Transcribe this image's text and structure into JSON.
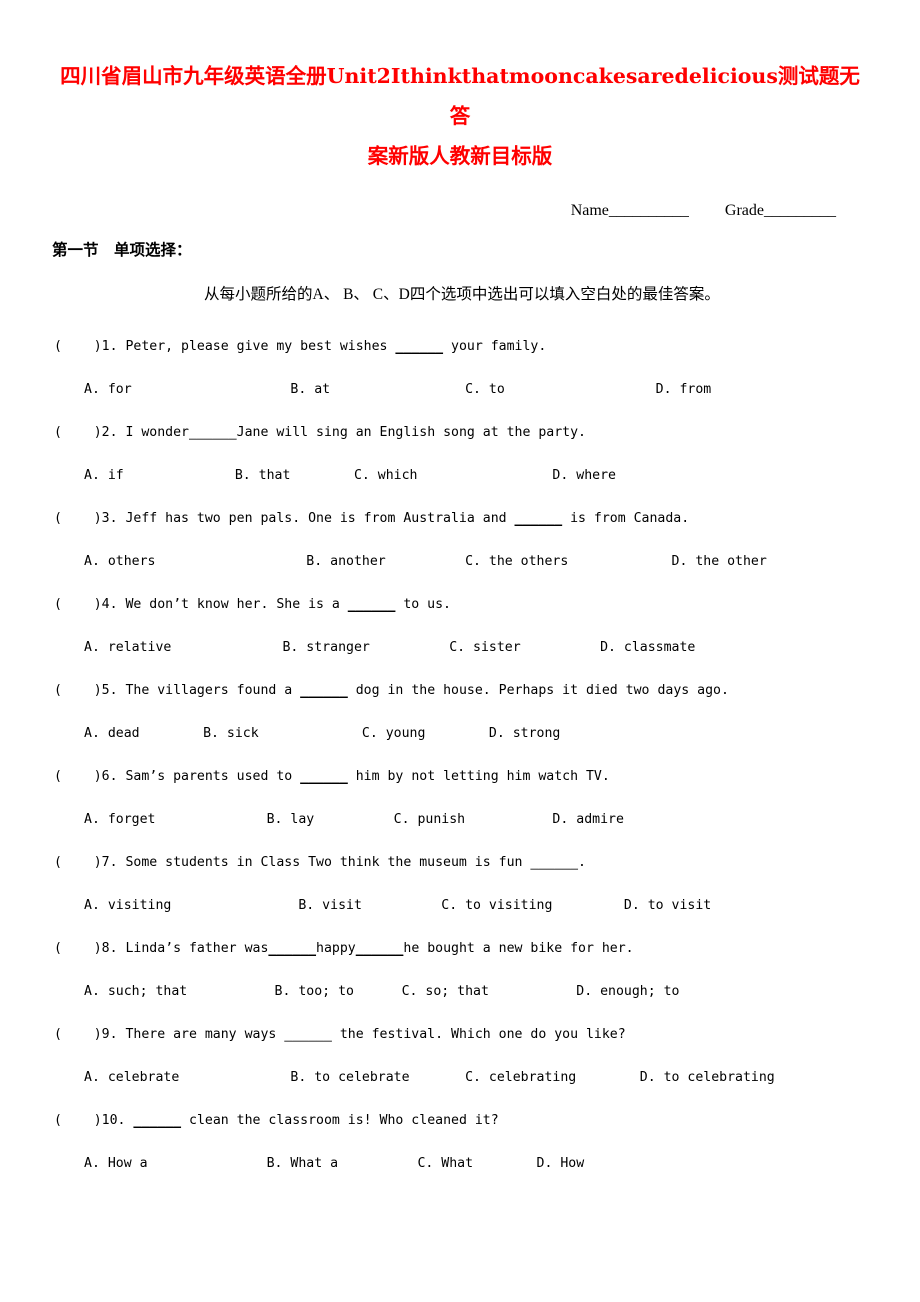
{
  "document": {
    "title_line1": "四川省眉山市九年级英语全册Unit2Ithinkthatmooncakesaredelicious测试题无答",
    "title_line2": "案新版人教新目标版",
    "title_color": "#ff0000",
    "name_label": "Name",
    "name_blank": "__________",
    "grade_label": "Grade",
    "grade_blank": "_________",
    "section_heading": "第一节　单项选择：",
    "instruction": "从每小题所给的A、 B、 C、D四个选项中选出可以填入空白处的最佳答案。"
  },
  "questions": [
    {
      "marker": "(    )1.",
      "stem_before": " Peter, please give my best wishes ",
      "blank": "______",
      "blank_style": "solid",
      "stem_after": " your family.",
      "options_text": "A. for                    B. at                 C. to                   D. from",
      "options": [
        "A. for",
        "B. at",
        "C. to",
        "D. from"
      ]
    },
    {
      "marker": "(    )2.",
      "stem_before": " I wonder",
      "blank": "______",
      "blank_style": "light",
      "stem_after": "Jane will sing an English song at the party.",
      "options_text": "A. if              B. that        C. which                 D. where",
      "options": [
        "A. if",
        "B. that",
        "C. which",
        "D. where"
      ]
    },
    {
      "marker": "(    )3.",
      "stem_before": " Jeff has two pen pals. One is from Australia and ",
      "blank": "______",
      "blank_style": "solid",
      "stem_after": " is from Canada.",
      "options_text": "A. others                   B. another          C. the others             D. the other",
      "options": [
        "A. others",
        "B. another",
        "C. the others",
        "D. the other"
      ]
    },
    {
      "marker": "(    )4.",
      "stem_before": " We don’t know her. She is a ",
      "blank": "______",
      "blank_style": "solid",
      "stem_after": " to us.",
      "options_text": "A. relative              B. stranger          C. sister          D. classmate",
      "options": [
        "A. relative",
        "B. stranger",
        "C. sister",
        "D. classmate"
      ]
    },
    {
      "marker": "(    )5.",
      "stem_before": " The villagers found a ",
      "blank": "______",
      "blank_style": "solid",
      "stem_after": " dog in the house. Perhaps it died two days ago.",
      "options_text": "A. dead        B. sick             C. young        D. strong",
      "options": [
        "A. dead",
        "B. sick",
        "C. young",
        "D. strong"
      ]
    },
    {
      "marker": "(    )6.",
      "stem_before": " Sam’s parents used to ",
      "blank": "______",
      "blank_style": "solid",
      "stem_after": " him by not letting him watch TV.",
      "options_text": "A. forget              B. lay          C. punish           D. admire",
      "options": [
        "A. forget",
        "B. lay",
        "C. punish",
        "D. admire"
      ]
    },
    {
      "marker": "(    )7.",
      "stem_before": " Some students in Class Two think the museum is fun ",
      "blank": "______",
      "blank_style": "light",
      "stem_after": ".",
      "options_text": "A. visiting                B. visit          C. to visiting         D. to visit",
      "options": [
        "A. visiting",
        "B. visit",
        "C. to visiting",
        "D. to visit"
      ]
    },
    {
      "marker": "(    )8.",
      "stem_before": " Linda’s father was",
      "blank": "______",
      "blank_style": "solid",
      "stem_mid": "happy",
      "blank2": "______",
      "stem_after": "he bought a new bike for her.",
      "options_text": "A. such; that           B. too; to      C. so; that           D. enough; to",
      "options": [
        "A. such; that",
        "B. too; to",
        "C. so; that",
        "D. enough; to"
      ]
    },
    {
      "marker": "(    )9.",
      "stem_before": " There are many ways ",
      "blank": "______",
      "blank_style": "light",
      "stem_after": " the festival. Which one do you like?",
      "options_text": "A. celebrate              B. to celebrate       C. celebrating        D. to celebrating",
      "options": [
        "A. celebrate",
        "B. to celebrate",
        "C. celebrating",
        "D. to celebrating"
      ]
    },
    {
      "marker": "(    )10.",
      "stem_before": " ",
      "blank": "______",
      "blank_style": "solid",
      "stem_after": " clean the classroom is! Who cleaned it?",
      "options_text": "A. How a               B. What a          C. What        D. How",
      "options": [
        "A. How a",
        "B. What a",
        "C. What",
        "D. How"
      ]
    }
  ]
}
